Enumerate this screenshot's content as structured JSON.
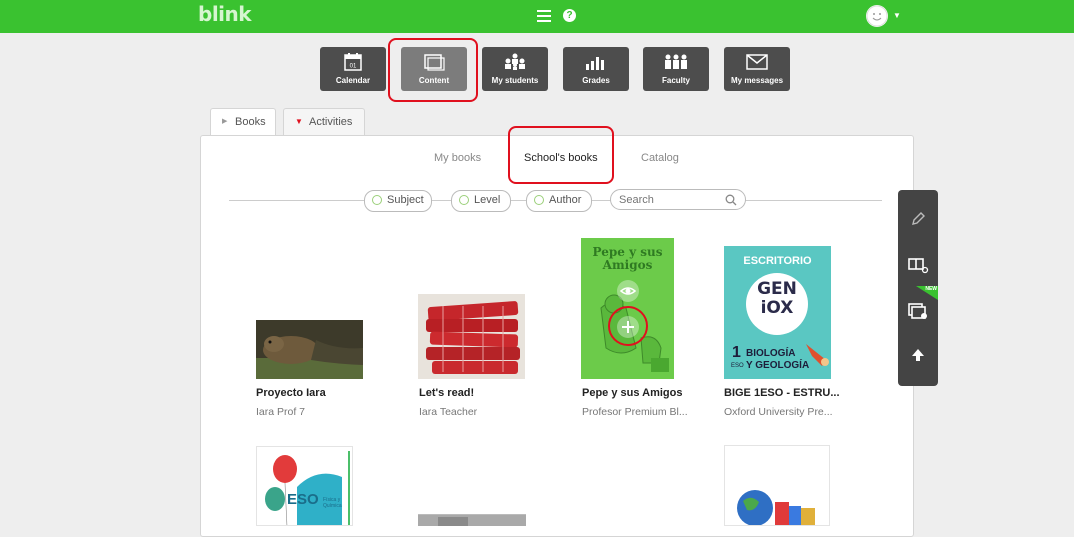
{
  "app": {
    "logo": "blink"
  },
  "nav": {
    "items": [
      {
        "label": "Calendar",
        "icon": "calendar-icon"
      },
      {
        "label": "Content",
        "icon": "content-icon",
        "active": true
      },
      {
        "label": "My students",
        "icon": "students-icon"
      },
      {
        "label": "Grades",
        "icon": "grades-icon"
      },
      {
        "label": "Faculty",
        "icon": "faculty-icon"
      },
      {
        "label": "My messages",
        "icon": "messages-icon"
      }
    ],
    "calendar_day": "01"
  },
  "tabs": [
    {
      "label": "Books",
      "selected": true
    },
    {
      "label": "Activities"
    }
  ],
  "subtabs": [
    {
      "label": "My books"
    },
    {
      "label": "School's books",
      "selected": true
    },
    {
      "label": "Catalog"
    }
  ],
  "filters": [
    {
      "label": "Subject"
    },
    {
      "label": "Level"
    },
    {
      "label": "Author"
    }
  ],
  "search": {
    "placeholder": "Search"
  },
  "books": [
    {
      "title": "Proyecto Iara",
      "author": "Iara Prof 7"
    },
    {
      "title": "Let's read!",
      "author": "Iara Teacher"
    },
    {
      "title": "Pepe y sus Amigos",
      "author": "Profesor Premium Bl..."
    },
    {
      "title": "BIGE 1ESO - ESTRU...",
      "author": "Oxford University Pre..."
    }
  ],
  "covers": {
    "pepe": "Pepe y sus Amigos",
    "bige_header": "ESCRITORIO",
    "bige_logo_top": "GEN",
    "bige_logo_bottom": "iOX",
    "bige_level_num": "1",
    "bige_level_txt": "ESO",
    "bige_subject1": "BIOLOGÍA",
    "bige_subject2": "Y GEOLOGÍA",
    "fq_level": "ESO",
    "fq_subject": "Física y Química"
  },
  "side_tools": {
    "new_badge": "NEW"
  },
  "colors": {
    "brand": "#3ac230",
    "highlight": "#e0101e",
    "nav_bg": "#4d4d4d"
  }
}
